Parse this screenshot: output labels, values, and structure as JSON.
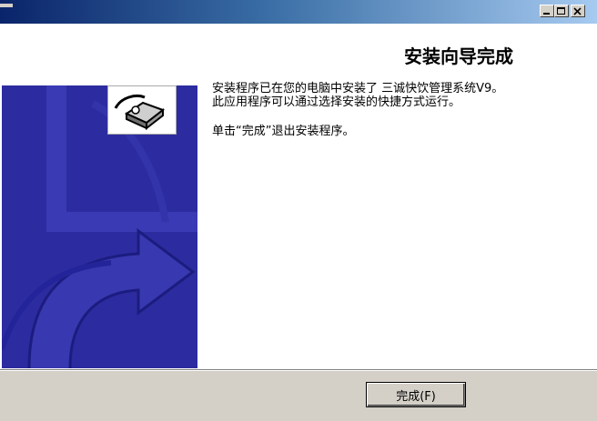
{
  "window": {
    "controls": {
      "minimize_icon": "minimize-icon",
      "maximize_icon": "maximize-icon",
      "close_icon": "close-icon"
    }
  },
  "page": {
    "title": "安装向导完成",
    "paragraph_line1": "安装程序已在您的电脑中安装了 三诚快饮管理系统V9。",
    "paragraph_line2": "此应用程序可以通过选择安装的快捷方式运行。",
    "paragraph_line3": "单击“完成”退出安装程序。"
  },
  "buttons": {
    "finish_label": "完成(F)"
  },
  "colors": {
    "banner": "#2c2ca0",
    "dialog_face": "#d4d0c8",
    "titlebar_start": "#0a246a"
  }
}
